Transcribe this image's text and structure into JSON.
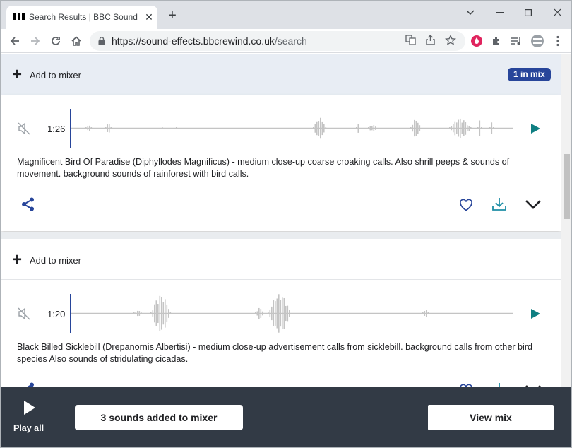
{
  "browser": {
    "tab_title": "Search Results | BBC Sound Effe",
    "url_host": "https://sound-effects.bbcrewind.co.uk",
    "url_path": "/search"
  },
  "colors": {
    "accent": "#27459a",
    "play": "#0f7f82",
    "player_bg": "#323a45",
    "wave": "#c4c4c4"
  },
  "results": [
    {
      "mixer_label": "Add to mixer",
      "mix_badge": "1 in mix",
      "duration": "1:26",
      "description": "Magnificent Bird Of Paradise (Diphyllodes Magnificus) - medium close-up coarse croaking calls. Also shrill peeps & sounds of movement. background sounds of rainforest with bird calls."
    },
    {
      "mixer_label": "Add to mixer",
      "duration": "1:20",
      "description": "Black Billed Sicklebill (Drepanornis Albertisi) - medium close-up advertisement calls from sicklebill. background calls from other bird species Also sounds of stridulating cicadas."
    }
  ],
  "player": {
    "play_all_label": "Play all",
    "sounds_added_label": "3 sounds added to mixer",
    "view_mix_label": "View mix"
  }
}
